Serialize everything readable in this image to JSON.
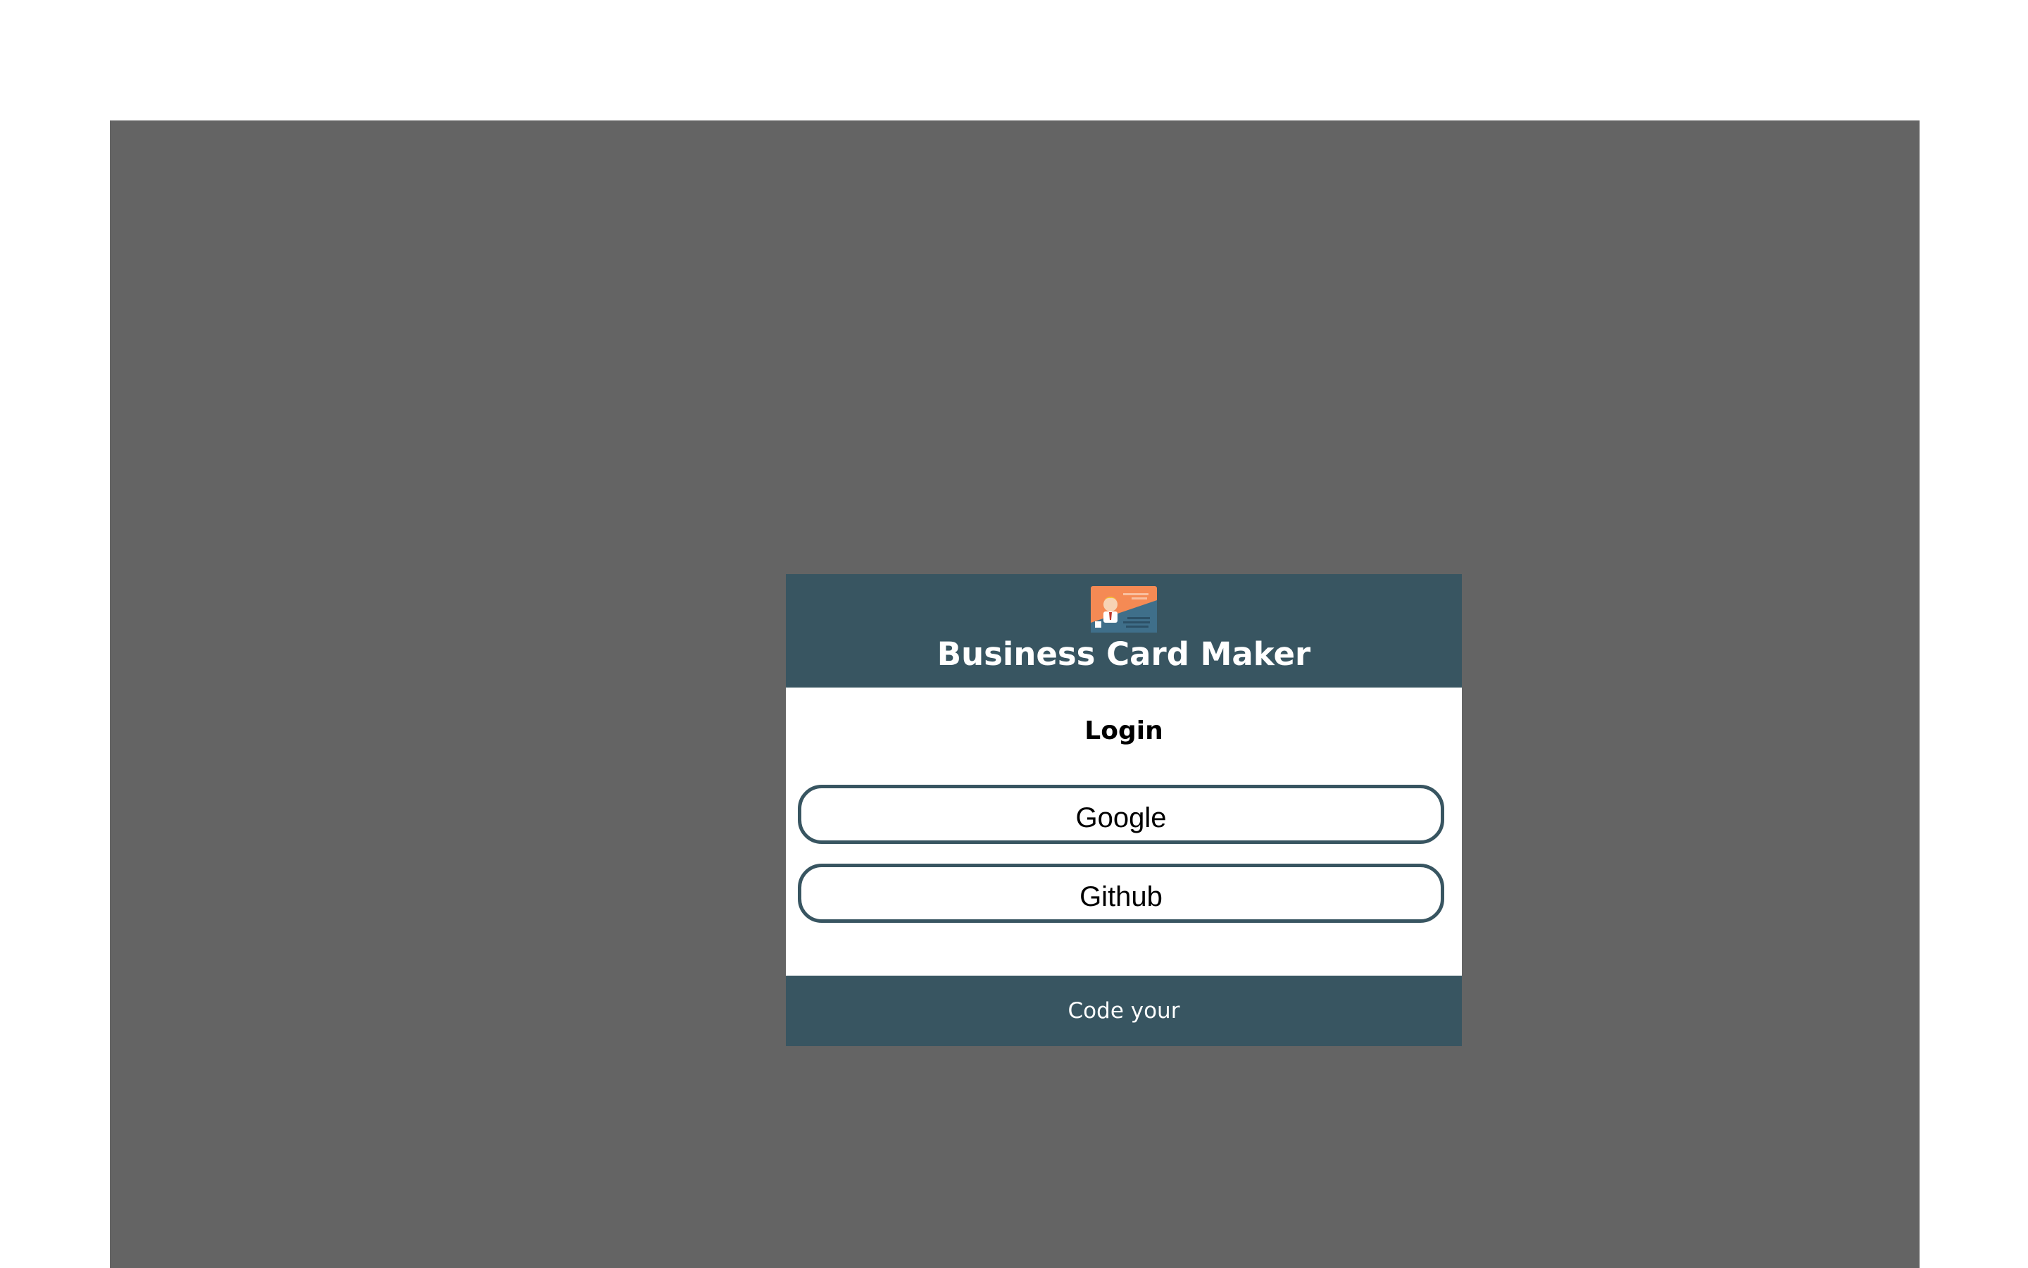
{
  "header": {
    "title": "Business Card Maker",
    "logo_icon": "business-card-logo-icon"
  },
  "login": {
    "heading": "Login",
    "buttons": [
      {
        "label": "Google"
      },
      {
        "label": "Github"
      }
    ]
  },
  "footer": {
    "text": "Code your"
  },
  "colors": {
    "overlay": "#646464",
    "brand": "#385561",
    "card_orange": "#f58a54"
  }
}
